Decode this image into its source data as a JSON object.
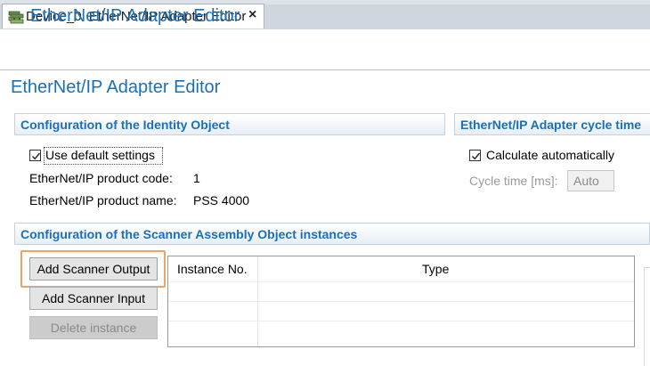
{
  "tab": {
    "title": "Device_0: EtherNet/IP Adapter Editor",
    "close_label": "×",
    "icon": "device-editor-icon"
  },
  "header": {
    "title": "EtherNet/IP Adapter Editor",
    "icon": "adapter-icon"
  },
  "main_title": "EtherNet/IP Adapter Editor",
  "identity": {
    "section_title": "Configuration of the Identity Object",
    "use_default_label": "Use default settings",
    "use_default_checked": true,
    "product_code_label": "EtherNet/IP product code:",
    "product_code_value": "1",
    "product_name_label": "EtherNet/IP product name:",
    "product_name_value": "PSS 4000"
  },
  "cycle": {
    "section_title": "EtherNet/IP Adapter cycle time",
    "calc_label": "Calculate automatically",
    "calc_checked": true,
    "cycle_time_label": "Cycle time [ms]:",
    "cycle_time_value": "Auto"
  },
  "scanner": {
    "section_title": "Configuration of the Scanner Assembly Object instances",
    "add_output_label": "Add Scanner Output",
    "add_input_label": "Add Scanner Input",
    "delete_label": "Delete instance",
    "table": {
      "columns": [
        "Instance No.",
        "Type"
      ],
      "rows": []
    }
  },
  "colors": {
    "title_blue": "#1a70b8",
    "highlight_orange": "#f0a35c"
  }
}
